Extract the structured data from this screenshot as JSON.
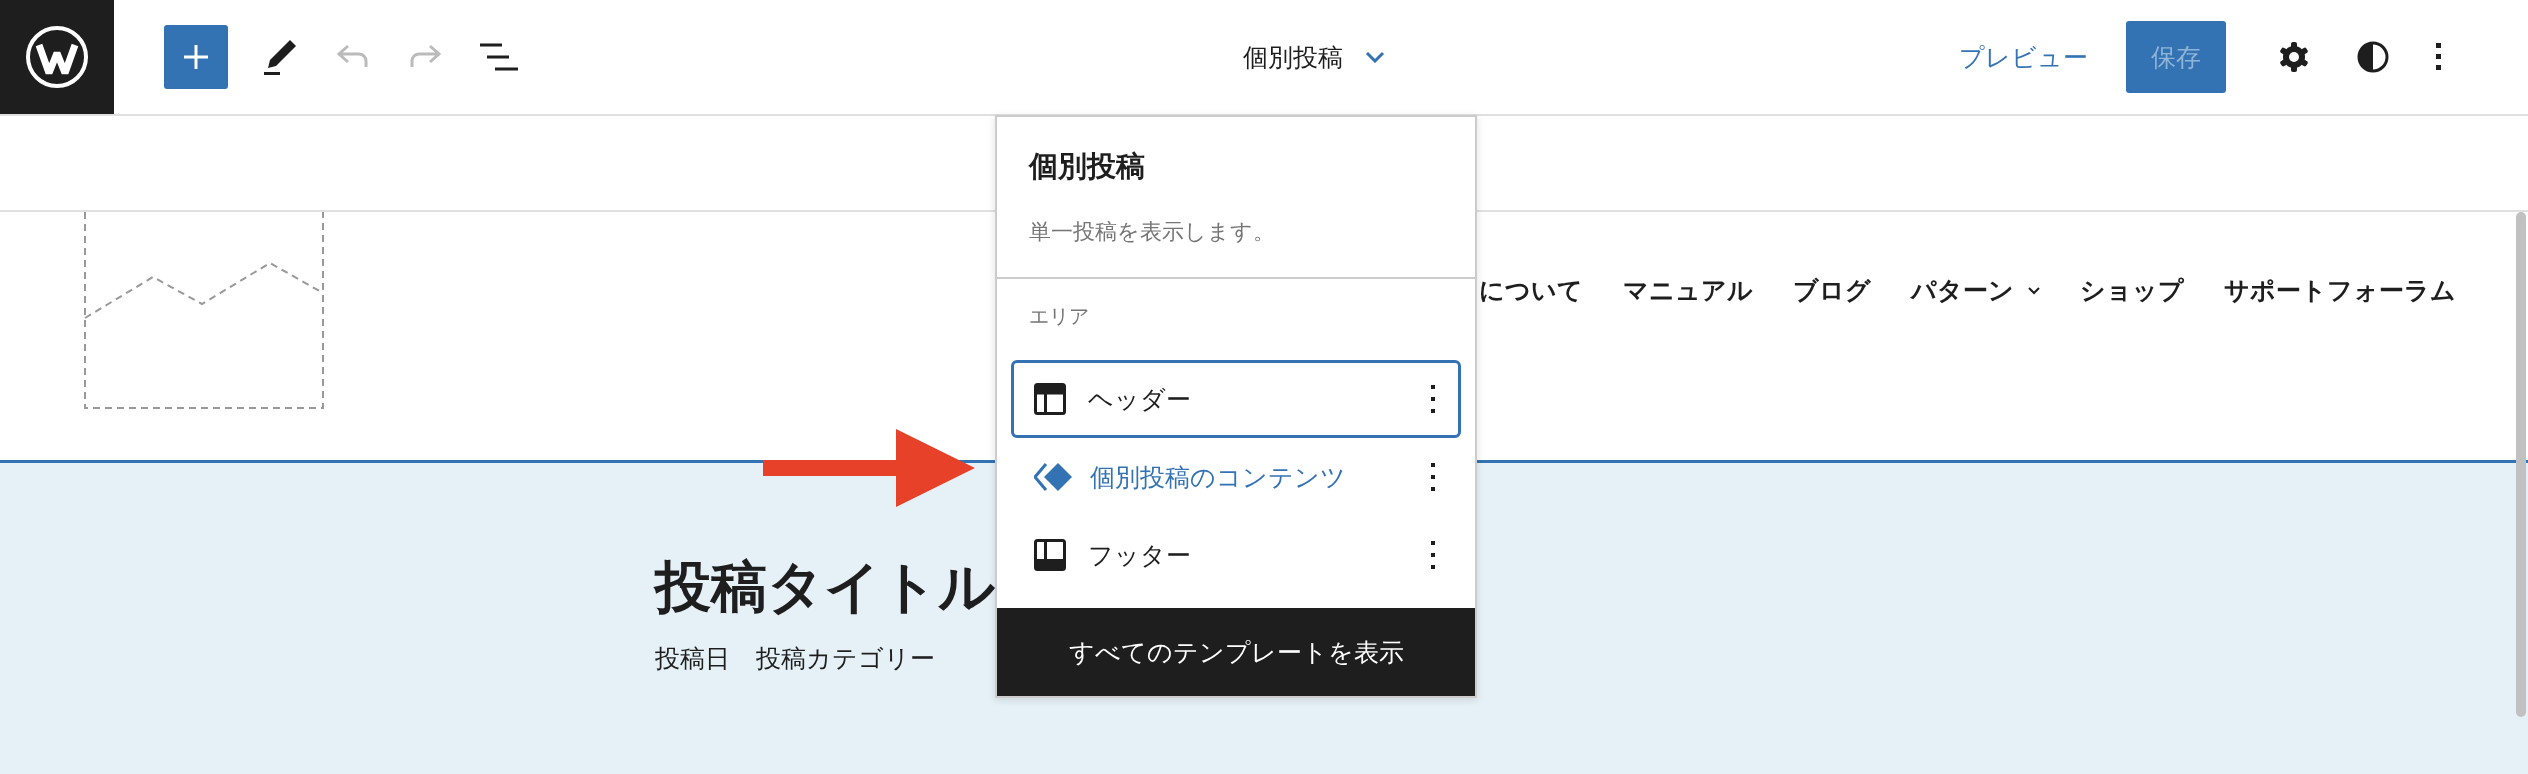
{
  "toolbar": {
    "title": "個別投稿",
    "undo_disabled": true,
    "redo_disabled": true,
    "preview": "プレビュー",
    "save": {
      "label": "保存",
      "disabled": true
    }
  },
  "site_nav": [
    {
      "label": "について",
      "has_submenu": false
    },
    {
      "label": "マニュアル",
      "has_submenu": false
    },
    {
      "label": "ブログ",
      "has_submenu": false
    },
    {
      "label": "パターン",
      "has_submenu": true
    },
    {
      "label": "ショップ",
      "has_submenu": false
    },
    {
      "label": "サポートフォーラム",
      "has_submenu": false
    }
  ],
  "post": {
    "title": "投稿タイトル",
    "date": "投稿日",
    "category": "投稿カテゴリー"
  },
  "template_menu": {
    "title": "個別投稿",
    "description": "単一投稿を表示します。",
    "section_label": "エリア",
    "areas": [
      {
        "label": "ヘッダー",
        "kind": "header",
        "selected": true
      },
      {
        "label": "個別投稿のコンテンツ",
        "kind": "content",
        "selected": false
      },
      {
        "label": "フッター",
        "kind": "footer",
        "selected": false
      }
    ],
    "view_all": "すべてのテンプレートを表示"
  }
}
